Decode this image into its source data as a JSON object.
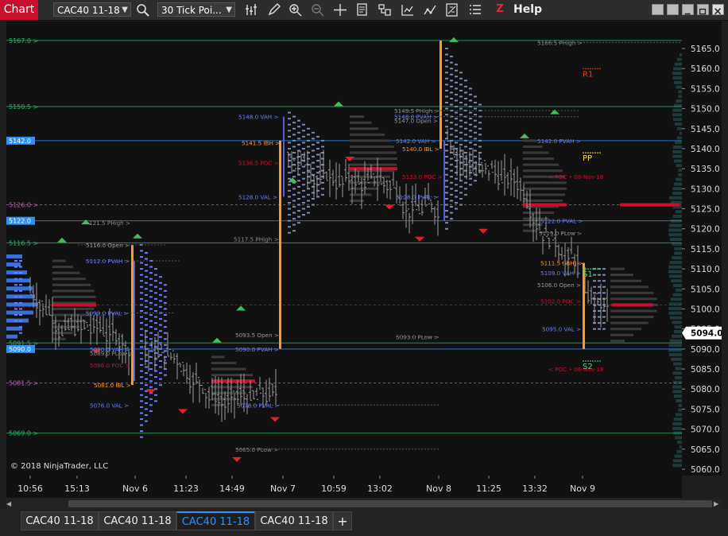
{
  "toolbar": {
    "chart_label": "Chart",
    "instrument": "CAC40 11-18",
    "bar_type": "30 Tick Poi...",
    "help_label": "Help",
    "z_label": "Z",
    "icons": [
      "search-icon",
      "bar-settings-icon",
      "pencil-icon",
      "zoom-in-icon",
      "zoom-out-icon",
      "crosshair-icon",
      "data-box-icon",
      "properties-icon",
      "strategies-icon",
      "indicators-icon",
      "drawing-tools-icon",
      "templates-icon"
    ]
  },
  "chart": {
    "copyright": "© 2018 NinjaTrader, LLC",
    "current_price": "5094.0",
    "price_ticks": [
      "5165.0",
      "5160.0",
      "5155.0",
      "5150.0",
      "5145.0",
      "5140.0",
      "5135.0",
      "5130.0",
      "5125.0",
      "5120.0",
      "5115.0",
      "5110.0",
      "5105.0",
      "5100.0",
      "5095.0",
      "5090.0",
      "5085.0",
      "5080.0",
      "5075.0",
      "5070.0",
      "5065.0",
      "5060.0"
    ],
    "time_ticks": [
      "10:56",
      "15:13",
      "Nov 6",
      "11:23",
      "14:49",
      "Nov 7",
      "10:59",
      "13:02",
      "Nov 8",
      "11:25",
      "13:32",
      "Nov 9"
    ],
    "left_level_tags": [
      {
        "label": "5167.0 >",
        "color": "#2fb36b"
      },
      {
        "label": "5150.5 >",
        "color": "#2fb36b"
      },
      {
        "label": "5142.0",
        "color": "#2e8fff"
      },
      {
        "label": "5126.0 >",
        "color": "#c05ac0"
      },
      {
        "label": "5122.0",
        "color": "#2e8fff"
      },
      {
        "label": "5116.5 >",
        "color": "#2fb36b"
      },
      {
        "label": "5101.0 >",
        "color": "#c8102e"
      },
      {
        "label": "5091.5 >",
        "color": "#2fb36b"
      },
      {
        "label": "5090.0",
        "color": "#2e8fff"
      },
      {
        "label": "5081.5 >",
        "color": "#c05ac0"
      },
      {
        "label": "5069.0 >",
        "color": "#2fb36b"
      }
    ],
    "annotations": [
      {
        "text": "121.5 PHigh >",
        "color": "#888"
      },
      {
        "text": "5116.0 Open >",
        "color": "#999"
      },
      {
        "text": "5112.0 PVAH >",
        "color": "#6a7cff"
      },
      {
        "text": "5099.0 PVAL >",
        "color": "#6a7cff"
      },
      {
        "text": "5090.0 VAH >",
        "color": "#6a7cff"
      },
      {
        "text": "5089.0 PLow >",
        "color": "#888"
      },
      {
        "text": "5086.0 POC >",
        "color": "#c8102e"
      },
      {
        "text": "5081.0 IBL >",
        "color": "#ff9a1f"
      },
      {
        "text": "5076.0 VAL >",
        "color": "#6a7cff"
      },
      {
        "text": "5148.0 VAH >",
        "color": "#6a7cff"
      },
      {
        "text": "5141.5 IBH >",
        "color": "#ff9a1f"
      },
      {
        "text": "5136.5 POC >",
        "color": "#c8102e"
      },
      {
        "text": "5128.0 VAL >",
        "color": "#6a7cff"
      },
      {
        "text": "5117.5 PHigh >",
        "color": "#888"
      },
      {
        "text": "5093.5 Open >",
        "color": "#999"
      },
      {
        "text": "5090.0 PVAH >",
        "color": "#6a7cff"
      },
      {
        "text": "5076.0 PVAL >",
        "color": "#6a7cff"
      },
      {
        "text": "5065.0 PLow >",
        "color": "#888"
      },
      {
        "text": "5149.5 PHigh >",
        "color": "#888"
      },
      {
        "text": "5148.0 PVAH >",
        "color": "#6a7cff"
      },
      {
        "text": "5147.0 Open >",
        "color": "#999"
      },
      {
        "text": "5142.0 VAH >",
        "color": "#6a7cff"
      },
      {
        "text": "5140.0 IBL >",
        "color": "#ff9a1f"
      },
      {
        "text": "5133.0 POC >",
        "color": "#c8102e"
      },
      {
        "text": "5128.0 PVAL >",
        "color": "#6a7cff"
      },
      {
        "text": "5093.0 PLow >",
        "color": "#888"
      },
      {
        "text": "5166.5 PHigh >",
        "color": "#888"
      },
      {
        "text": "5142.0 PVAH >",
        "color": "#6a7cff"
      },
      {
        "text": "< POC • 08-Nov-18",
        "color": "#c8102e"
      },
      {
        "text": "5122.0 PVAL >",
        "color": "#6a7cff"
      },
      {
        "text": "5119.0 PLow >",
        "color": "#888"
      },
      {
        "text": "5111.5 (IBH) >",
        "color": "#ff9a1f"
      },
      {
        "text": "5109.0 VAH >",
        "color": "#6a7cff"
      },
      {
        "text": "5106.0 Open >",
        "color": "#999"
      },
      {
        "text": "5102.0 POC >",
        "color": "#c8102e"
      },
      {
        "text": "5095.0 VAL >",
        "color": "#6a7cff"
      },
      {
        "text": "< POC • 06-Nov-18",
        "color": "#c8102e"
      }
    ],
    "pivots": [
      {
        "text": "R1",
        "color": "#e8401c"
      },
      {
        "text": "PP",
        "color": "#ffe14d"
      },
      {
        "text": "S1",
        "color": "#3fe07a"
      },
      {
        "text": "S2",
        "color": "#3fe07a"
      }
    ]
  },
  "bottom_tabs": [
    {
      "label": "CAC40 11-18",
      "active": false
    },
    {
      "label": "CAC40 11-18",
      "active": false
    },
    {
      "label": "CAC40 11-18",
      "active": true
    },
    {
      "label": "CAC40 11-18",
      "active": false
    }
  ],
  "add_tab_label": "+"
}
